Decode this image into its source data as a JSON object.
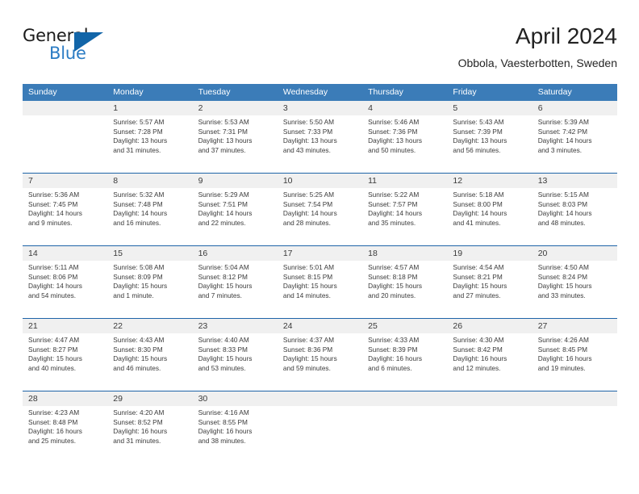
{
  "brand": {
    "name_part1": "General",
    "name_part2": "Blue",
    "logo_icon": "blue-triangle-icon",
    "color_dark": "#1a1a1a",
    "color_blue": "#2b7cc4",
    "triangle_color": "#1265a8"
  },
  "header": {
    "title": "April 2024",
    "subtitle": "Obbola, Vaesterbotten, Sweden"
  },
  "theme": {
    "header_bg": "#3b7cb8",
    "header_text": "#ffffff",
    "row_divider": "#1f64a8",
    "daynum_bg": "#f0f0f0",
    "body_text": "#3a3a3a"
  },
  "weekdays": [
    "Sunday",
    "Monday",
    "Tuesday",
    "Wednesday",
    "Thursday",
    "Friday",
    "Saturday"
  ],
  "weeks": [
    {
      "days": [
        {
          "num": "",
          "sunrise": "",
          "sunset": "",
          "daylight1": "",
          "daylight2": ""
        },
        {
          "num": "1",
          "sunrise": "Sunrise: 5:57 AM",
          "sunset": "Sunset: 7:28 PM",
          "daylight1": "Daylight: 13 hours",
          "daylight2": "and 31 minutes."
        },
        {
          "num": "2",
          "sunrise": "Sunrise: 5:53 AM",
          "sunset": "Sunset: 7:31 PM",
          "daylight1": "Daylight: 13 hours",
          "daylight2": "and 37 minutes."
        },
        {
          "num": "3",
          "sunrise": "Sunrise: 5:50 AM",
          "sunset": "Sunset: 7:33 PM",
          "daylight1": "Daylight: 13 hours",
          "daylight2": "and 43 minutes."
        },
        {
          "num": "4",
          "sunrise": "Sunrise: 5:46 AM",
          "sunset": "Sunset: 7:36 PM",
          "daylight1": "Daylight: 13 hours",
          "daylight2": "and 50 minutes."
        },
        {
          "num": "5",
          "sunrise": "Sunrise: 5:43 AM",
          "sunset": "Sunset: 7:39 PM",
          "daylight1": "Daylight: 13 hours",
          "daylight2": "and 56 minutes."
        },
        {
          "num": "6",
          "sunrise": "Sunrise: 5:39 AM",
          "sunset": "Sunset: 7:42 PM",
          "daylight1": "Daylight: 14 hours",
          "daylight2": "and 3 minutes."
        }
      ]
    },
    {
      "days": [
        {
          "num": "7",
          "sunrise": "Sunrise: 5:36 AM",
          "sunset": "Sunset: 7:45 PM",
          "daylight1": "Daylight: 14 hours",
          "daylight2": "and 9 minutes."
        },
        {
          "num": "8",
          "sunrise": "Sunrise: 5:32 AM",
          "sunset": "Sunset: 7:48 PM",
          "daylight1": "Daylight: 14 hours",
          "daylight2": "and 16 minutes."
        },
        {
          "num": "9",
          "sunrise": "Sunrise: 5:29 AM",
          "sunset": "Sunset: 7:51 PM",
          "daylight1": "Daylight: 14 hours",
          "daylight2": "and 22 minutes."
        },
        {
          "num": "10",
          "sunrise": "Sunrise: 5:25 AM",
          "sunset": "Sunset: 7:54 PM",
          "daylight1": "Daylight: 14 hours",
          "daylight2": "and 28 minutes."
        },
        {
          "num": "11",
          "sunrise": "Sunrise: 5:22 AM",
          "sunset": "Sunset: 7:57 PM",
          "daylight1": "Daylight: 14 hours",
          "daylight2": "and 35 minutes."
        },
        {
          "num": "12",
          "sunrise": "Sunrise: 5:18 AM",
          "sunset": "Sunset: 8:00 PM",
          "daylight1": "Daylight: 14 hours",
          "daylight2": "and 41 minutes."
        },
        {
          "num": "13",
          "sunrise": "Sunrise: 5:15 AM",
          "sunset": "Sunset: 8:03 PM",
          "daylight1": "Daylight: 14 hours",
          "daylight2": "and 48 minutes."
        }
      ]
    },
    {
      "days": [
        {
          "num": "14",
          "sunrise": "Sunrise: 5:11 AM",
          "sunset": "Sunset: 8:06 PM",
          "daylight1": "Daylight: 14 hours",
          "daylight2": "and 54 minutes."
        },
        {
          "num": "15",
          "sunrise": "Sunrise: 5:08 AM",
          "sunset": "Sunset: 8:09 PM",
          "daylight1": "Daylight: 15 hours",
          "daylight2": "and 1 minute."
        },
        {
          "num": "16",
          "sunrise": "Sunrise: 5:04 AM",
          "sunset": "Sunset: 8:12 PM",
          "daylight1": "Daylight: 15 hours",
          "daylight2": "and 7 minutes."
        },
        {
          "num": "17",
          "sunrise": "Sunrise: 5:01 AM",
          "sunset": "Sunset: 8:15 PM",
          "daylight1": "Daylight: 15 hours",
          "daylight2": "and 14 minutes."
        },
        {
          "num": "18",
          "sunrise": "Sunrise: 4:57 AM",
          "sunset": "Sunset: 8:18 PM",
          "daylight1": "Daylight: 15 hours",
          "daylight2": "and 20 minutes."
        },
        {
          "num": "19",
          "sunrise": "Sunrise: 4:54 AM",
          "sunset": "Sunset: 8:21 PM",
          "daylight1": "Daylight: 15 hours",
          "daylight2": "and 27 minutes."
        },
        {
          "num": "20",
          "sunrise": "Sunrise: 4:50 AM",
          "sunset": "Sunset: 8:24 PM",
          "daylight1": "Daylight: 15 hours",
          "daylight2": "and 33 minutes."
        }
      ]
    },
    {
      "days": [
        {
          "num": "21",
          "sunrise": "Sunrise: 4:47 AM",
          "sunset": "Sunset: 8:27 PM",
          "daylight1": "Daylight: 15 hours",
          "daylight2": "and 40 minutes."
        },
        {
          "num": "22",
          "sunrise": "Sunrise: 4:43 AM",
          "sunset": "Sunset: 8:30 PM",
          "daylight1": "Daylight: 15 hours",
          "daylight2": "and 46 minutes."
        },
        {
          "num": "23",
          "sunrise": "Sunrise: 4:40 AM",
          "sunset": "Sunset: 8:33 PM",
          "daylight1": "Daylight: 15 hours",
          "daylight2": "and 53 minutes."
        },
        {
          "num": "24",
          "sunrise": "Sunrise: 4:37 AM",
          "sunset": "Sunset: 8:36 PM",
          "daylight1": "Daylight: 15 hours",
          "daylight2": "and 59 minutes."
        },
        {
          "num": "25",
          "sunrise": "Sunrise: 4:33 AM",
          "sunset": "Sunset: 8:39 PM",
          "daylight1": "Daylight: 16 hours",
          "daylight2": "and 6 minutes."
        },
        {
          "num": "26",
          "sunrise": "Sunrise: 4:30 AM",
          "sunset": "Sunset: 8:42 PM",
          "daylight1": "Daylight: 16 hours",
          "daylight2": "and 12 minutes."
        },
        {
          "num": "27",
          "sunrise": "Sunrise: 4:26 AM",
          "sunset": "Sunset: 8:45 PM",
          "daylight1": "Daylight: 16 hours",
          "daylight2": "and 19 minutes."
        }
      ]
    },
    {
      "days": [
        {
          "num": "28",
          "sunrise": "Sunrise: 4:23 AM",
          "sunset": "Sunset: 8:48 PM",
          "daylight1": "Daylight: 16 hours",
          "daylight2": "and 25 minutes."
        },
        {
          "num": "29",
          "sunrise": "Sunrise: 4:20 AM",
          "sunset": "Sunset: 8:52 PM",
          "daylight1": "Daylight: 16 hours",
          "daylight2": "and 31 minutes."
        },
        {
          "num": "30",
          "sunrise": "Sunrise: 4:16 AM",
          "sunset": "Sunset: 8:55 PM",
          "daylight1": "Daylight: 16 hours",
          "daylight2": "and 38 minutes."
        },
        {
          "num": "",
          "sunrise": "",
          "sunset": "",
          "daylight1": "",
          "daylight2": ""
        },
        {
          "num": "",
          "sunrise": "",
          "sunset": "",
          "daylight1": "",
          "daylight2": ""
        },
        {
          "num": "",
          "sunrise": "",
          "sunset": "",
          "daylight1": "",
          "daylight2": ""
        },
        {
          "num": "",
          "sunrise": "",
          "sunset": "",
          "daylight1": "",
          "daylight2": ""
        }
      ]
    }
  ]
}
